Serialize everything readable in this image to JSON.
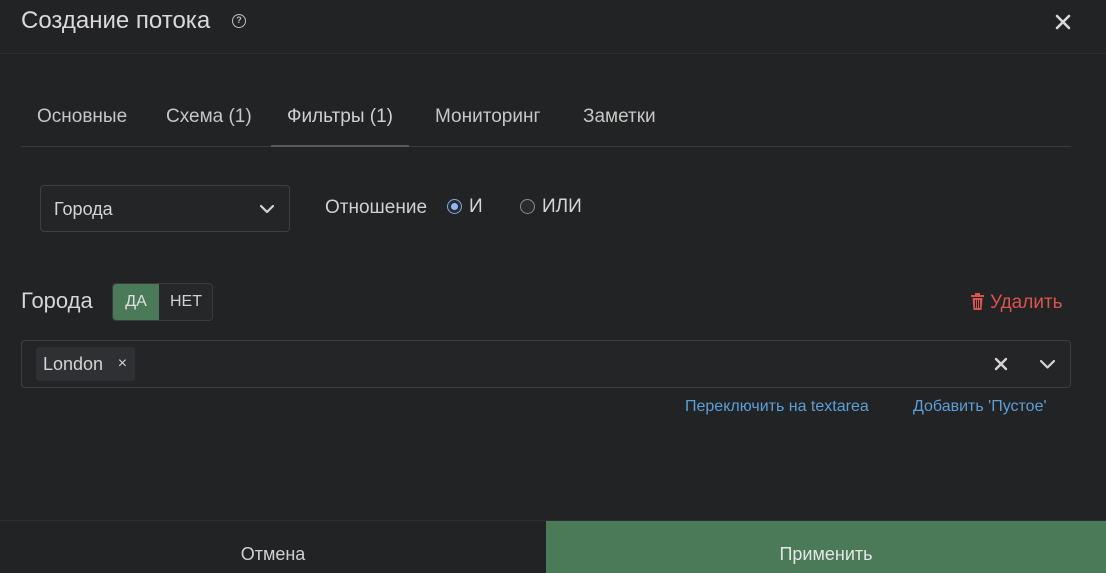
{
  "dialog": {
    "title": "Создание потока",
    "help_icon": "question-circle-icon",
    "close_icon": "close-icon"
  },
  "tabs": [
    {
      "label": "Основные",
      "active": false
    },
    {
      "label": "Схема (1)",
      "active": false
    },
    {
      "label": "Фильтры (1)",
      "active": true
    },
    {
      "label": "Мониторинг",
      "active": false
    },
    {
      "label": "Заметки",
      "active": false
    }
  ],
  "filter_select": {
    "value": "Города",
    "icon": "chevron-down-icon"
  },
  "relation": {
    "label": "Отношение",
    "options": [
      {
        "label": "И",
        "checked": true
      },
      {
        "label": "ИЛИ",
        "checked": false
      }
    ]
  },
  "filter_group": {
    "label": "Города",
    "toggle": {
      "yes": "ДА",
      "no": "НЕТ",
      "selected": "ДА"
    },
    "delete_label": "Удалить",
    "delete_icon": "trash-icon",
    "tags": [
      {
        "label": "London",
        "remove": "×"
      }
    ],
    "links": {
      "switch_textarea": "Переключить на textarea",
      "add_empty": "Добавить 'Пустое'"
    }
  },
  "footer": {
    "cancel": "Отмена",
    "apply": "Применить"
  },
  "colors": {
    "background": "#222325",
    "accent_green": "#4a7a57",
    "danger": "#d9534f",
    "link": "#5b9fd6",
    "radio_active": "#8fb8f8"
  }
}
